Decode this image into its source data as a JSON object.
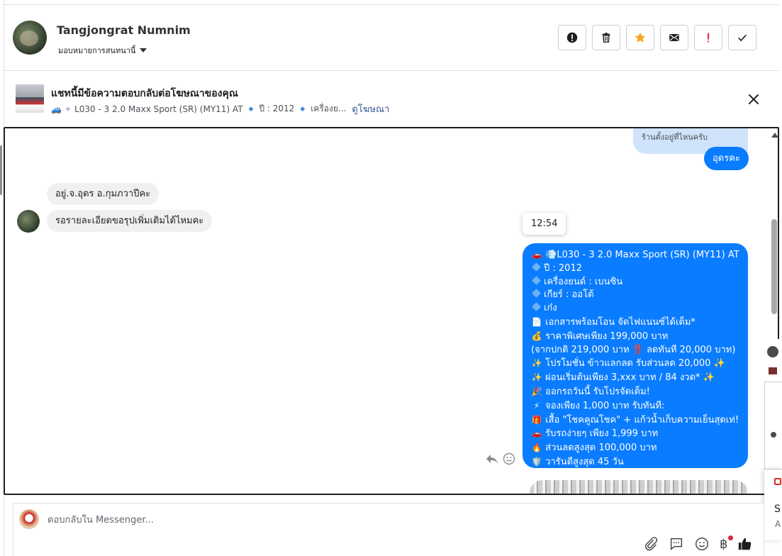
{
  "header": {
    "user_name": "Tangjongrat Numnim",
    "assign_label": "มอบหมายการสนทนานี้"
  },
  "ad_banner": {
    "title": "แชทนี้มีข้อความตอบกลับต่อโฆษณาของคุณ",
    "model": "L030 - 3 2.0 Maxx Sport (SR) (MY11) AT",
    "year": "ปี : 2012",
    "engine_truncated": "เครื่องย...",
    "link": "ดูโฆษณา"
  },
  "messages": {
    "partial_top": "ร้านตั้งอยู่ที่ไหนครับ",
    "sent_1": "อุดรคะ",
    "recv_1": "อยู่.จ.อุดร อ.กุมภวาปีคะ",
    "recv_2": "รอรายละเอียดขอรุปเพิ่มเติมได้ไหมคะ",
    "timestamp": "12:54",
    "listing": [
      {
        "icon": "🚗",
        "text": "💨L030 - 3 2.0 Maxx Sport (SR) (MY11) AT"
      },
      {
        "icon": "diamond",
        "text": "ปี : 2012"
      },
      {
        "icon": "diamond",
        "text": "เครื่องยนต์ : เบนซิน"
      },
      {
        "icon": "diamond",
        "text": "เกียร์ : ออโต้"
      },
      {
        "icon": "diamond",
        "text": "เก๋ง"
      },
      {
        "icon": "📄",
        "text": "เอกสารพร้อมโอน จัดไฟแนนซ์ได้เต็ม*"
      },
      {
        "icon": "💰",
        "text": "ราคาพิเศษเพียง 199,000 บาท"
      },
      {
        "icon": "",
        "text": "(จากปกติ 219,000 บาท ‼️ ลดทันที 20,000 บาท)"
      },
      {
        "icon": "✨",
        "text": "โปรโมชั่น ข้าวแลกลด รับส่วนลด 20,000 ✨"
      },
      {
        "icon": "✨",
        "text": "ผ่อนเริ่มต้นเพียง 3,xxx บาท / 84 งวด* ✨"
      },
      {
        "icon": "🎉",
        "text": "ออกรถวันนี้ รับโปรจัดเต็ม!"
      },
      {
        "icon": "⚡",
        "text": "จองเพียง 1,000 บาท รับทันที:"
      },
      {
        "icon": "🎁",
        "text": "เสื้อ \"โชคคูณโชค\" + แก้วน้ำเก็บความเย็นสุดเท่!"
      },
      {
        "icon": "🚗",
        "text": "รับรถง่ายๆ เพียง 1,999 บาท"
      },
      {
        "icon": "🔥",
        "text": "ส่วนลดสูงสุด 100,000 บาท"
      },
      {
        "icon": "🛡️",
        "text": "วารันตีสูงสุด 45 วัน"
      }
    ]
  },
  "side_panel": {
    "snippet_1": "S",
    "snippet_2": "A"
  },
  "composer": {
    "placeholder": "ตอบกลับใน Messenger..."
  },
  "colors": {
    "brand_blue": "#0a7cff",
    "star_orange": "#f5a623",
    "alert_red": "#e41e3f"
  }
}
